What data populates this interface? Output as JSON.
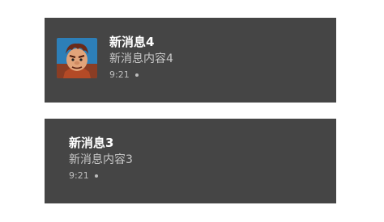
{
  "notifications": [
    {
      "title": "新消息4",
      "body": "新消息内容4",
      "time": "9:21",
      "has_avatar": true,
      "avatar_icon": "wreck-it-ralph-avatar"
    },
    {
      "title": "新消息3",
      "body": "新消息内容3",
      "time": "9:21",
      "has_avatar": false
    }
  ],
  "colors": {
    "card_background": "#454545",
    "title_text": "#ffffff",
    "body_text": "#c8c8c8",
    "meta_text": "#bdbdbd",
    "page_background": "#ffffff"
  }
}
